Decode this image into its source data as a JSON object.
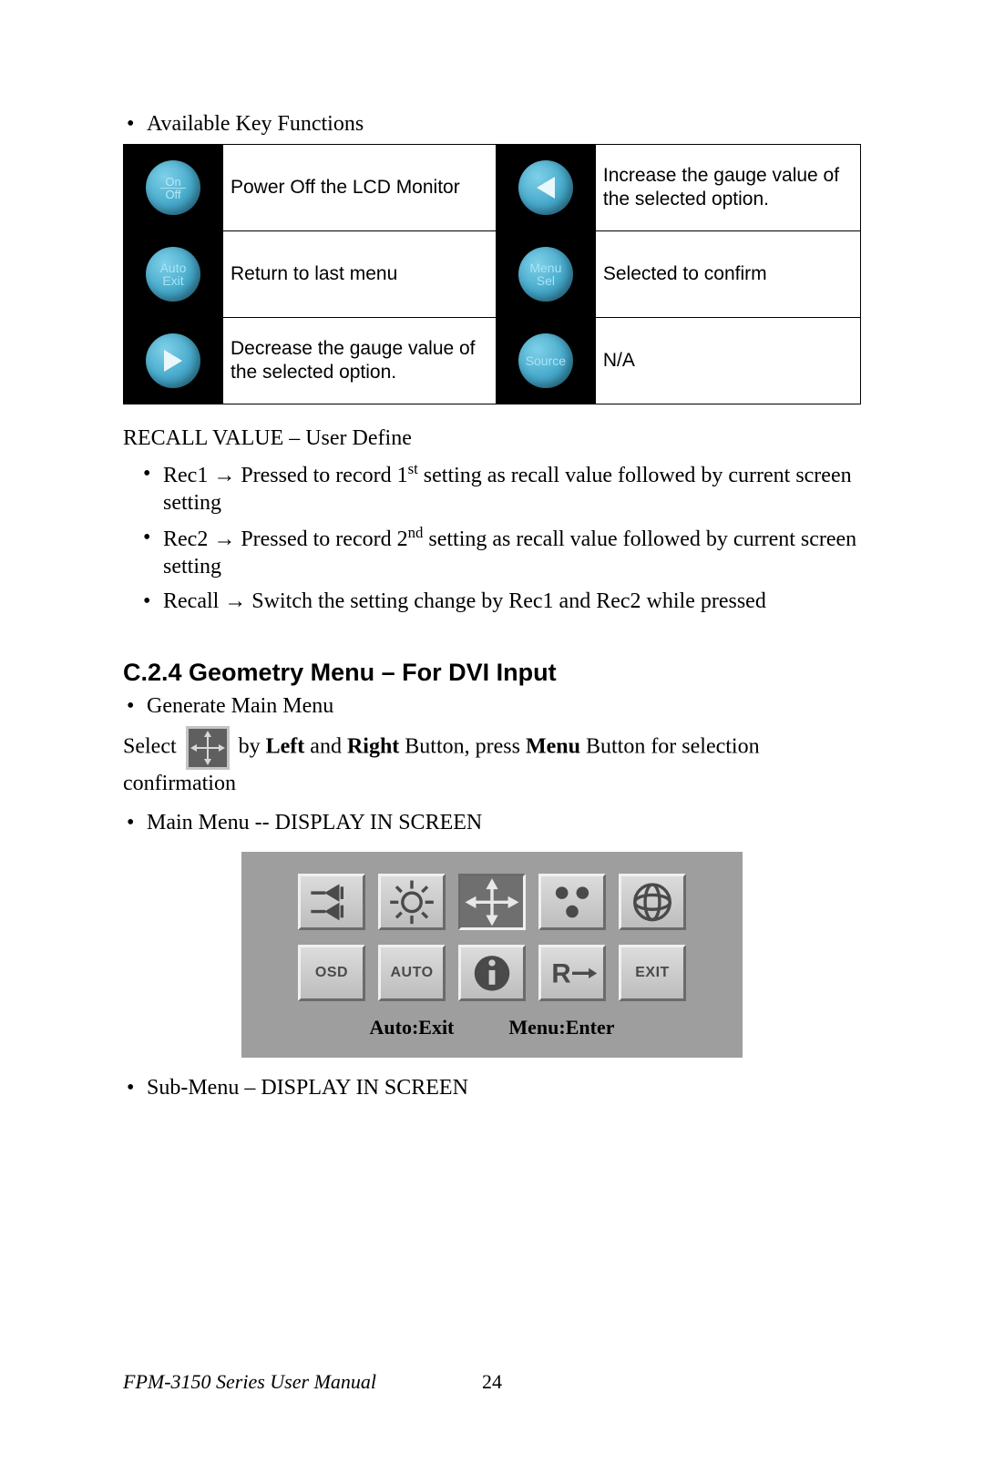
{
  "bullets_top": {
    "available_key_functions": "Available Key Functions"
  },
  "key_table": [
    {
      "icon": "onoff",
      "desc": "Power Off the LCD Monitor",
      "icon2": "left",
      "desc2": "Increase the gauge value of the selected option."
    },
    {
      "icon": "auto",
      "desc": "Return to last menu",
      "icon2": "menu",
      "desc2": "Selected to confirm"
    },
    {
      "icon": "play",
      "desc": "Decrease the gauge value of the selected option.",
      "icon2": "source",
      "desc2": "N/A"
    }
  ],
  "recall_heading": "RECALL VALUE – User Define",
  "recall_items": [
    {
      "label": "Rec1",
      "arrow": "→",
      "body_pre": "Pressed to record 1",
      "sup": "st",
      "body_post": " setting as recall value followed by current screen setting"
    },
    {
      "label": "Rec2",
      "arrow": "→",
      "body_pre": "Pressed to record 2",
      "sup": "nd",
      "body_post": " setting as recall value followed by current screen setting"
    },
    {
      "label": "Recall",
      "arrow": "→",
      "body_pre": "Switch the setting change by Rec1 and Rec2 while pressed",
      "sup": "",
      "body_post": ""
    }
  ],
  "section_heading": "C.2.4 Geometry Menu – For DVI Input",
  "generate_main": "Generate Main Menu",
  "select_line": {
    "pre": "Select ",
    "mid1": "by ",
    "left": "Left",
    "and": " and ",
    "right": "Right",
    "mid2": " Button, press ",
    "menu": "Menu",
    "mid3": " Button for selection confirmation"
  },
  "main_menu_display": "Main Menu -- DISPLAY IN SCREEN",
  "osd_icons_row1": [
    "adjust",
    "sun",
    "geometry",
    "dots",
    "globe"
  ],
  "osd_labels_row2": [
    "OSD",
    "AUTO",
    "i",
    "R→",
    "EXIT"
  ],
  "osd_footer": {
    "left": "Auto:Exit",
    "right": "Menu:Enter"
  },
  "sub_menu_display": "Sub-Menu – DISPLAY IN SCREEN",
  "footer": {
    "title": "FPM-3150 Series User Manual",
    "page": "24"
  },
  "btn_text": {
    "on": "On",
    "off": "Off",
    "auto": "Auto",
    "exit": "Exit",
    "menu": "Menu",
    "sel": "Sel",
    "source": "Source"
  }
}
